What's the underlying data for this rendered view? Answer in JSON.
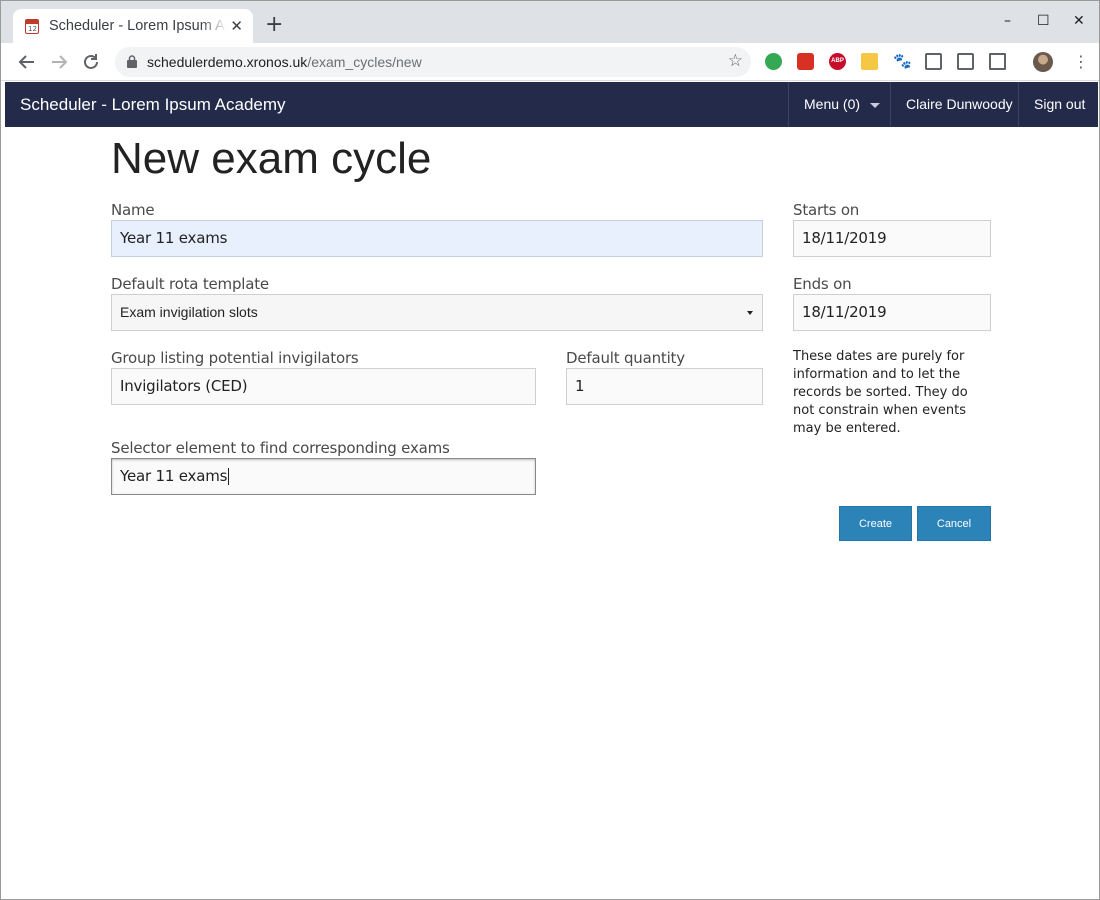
{
  "browser": {
    "tab_title": "Scheduler - Lorem Ipsum Academy",
    "tab_close": "✕",
    "new_tab": "+",
    "url_domain": "schedulerdemo.xronos.uk",
    "url_path": "/exam_cycles/new",
    "favicon_text": "12",
    "window_controls": {
      "minimize": "–",
      "maximize": "☐",
      "close": "✕"
    },
    "extensions": [
      "green-dot-icon",
      "red-puzzle-icon",
      "abp-icon",
      "house-icon",
      "paw-icon",
      "key-box-icon",
      "mail-icon",
      "screenshot-frame-icon"
    ],
    "abp_text": "ABP",
    "paw_glyph": "🐾"
  },
  "appbar": {
    "brand": "Scheduler - Lorem Ipsum Academy",
    "menu_label": "Menu (0)",
    "user_name": "Claire Dunwoody",
    "sign_out": "Sign out",
    "background": "#232a4a"
  },
  "page": {
    "title": "New exam cycle"
  },
  "form": {
    "name_label": "Name",
    "name_value": "Year 11 exams",
    "rota_label": "Default rota template",
    "rota_value": "Exam invigilation slots",
    "group_label": "Group listing potential invigilators",
    "group_value": "Invigilators (CED)",
    "quantity_label": "Default quantity",
    "quantity_value": "1",
    "selector_label": "Selector element to find corresponding exams",
    "selector_value": "Year 11 exams",
    "starts_label": "Starts on",
    "starts_value": "18/11/2019",
    "ends_label": "Ends on",
    "ends_value": "18/11/2019",
    "help_text": "These dates are purely for information and to let the records be sorted. They do not constrain when events may be entered.",
    "create_label": "Create",
    "cancel_label": "Cancel",
    "button_color": "#2b83b8"
  }
}
